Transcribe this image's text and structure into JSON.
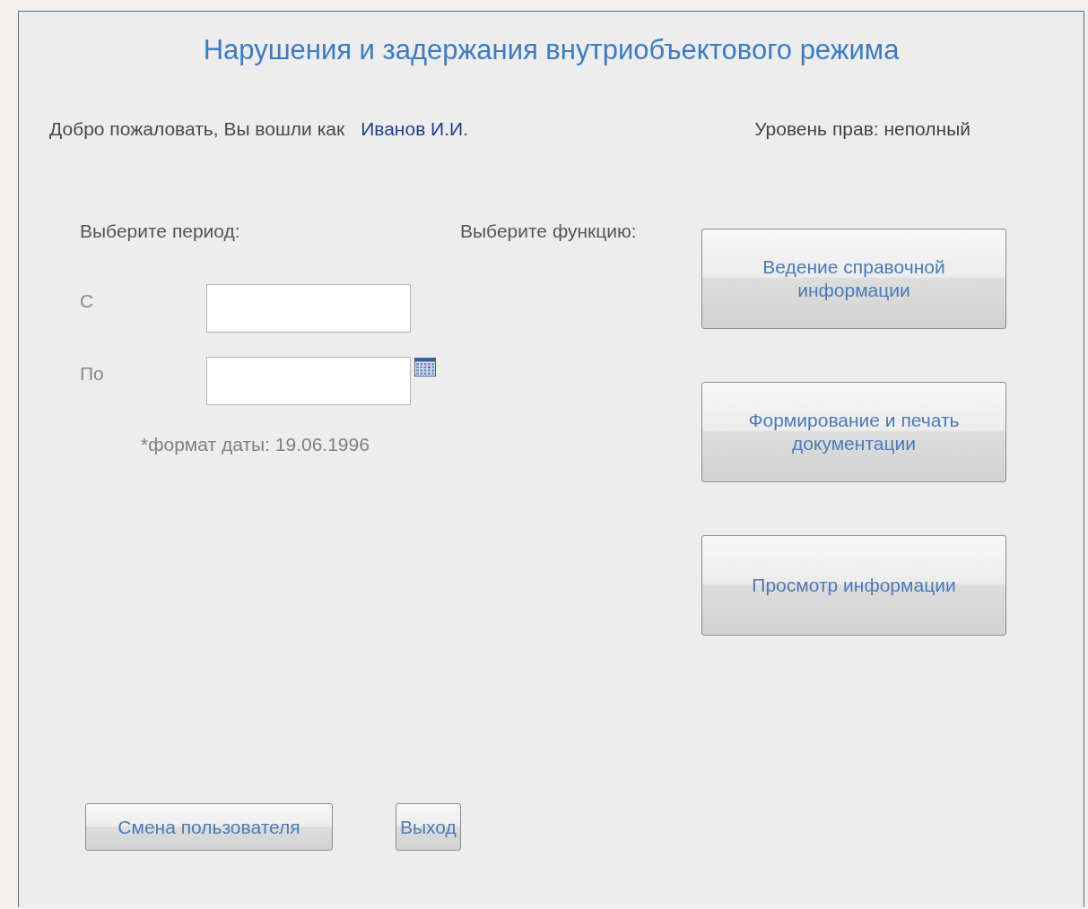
{
  "title": "Нарушения и задержания внутриобъектового режима",
  "welcome": {
    "text": "Добро пожаловать, Вы вошли как",
    "user": "Иванов И.И."
  },
  "access_level": "Уровень прав: неполный",
  "period": {
    "heading": "Выберите период:",
    "fields": [
      {
        "label": "С",
        "calendar": false
      },
      {
        "label": "По",
        "calendar": true
      }
    ],
    "format_hint": "*формат даты: 19.06.1996"
  },
  "functions": {
    "heading": "Выберите функцию:",
    "buttons": [
      "Ведение справочной информации",
      "Формирование и печать документации",
      "Просмотр информации"
    ]
  },
  "bottom_buttons": [
    "Смена пользователя",
    "Выход"
  ]
}
